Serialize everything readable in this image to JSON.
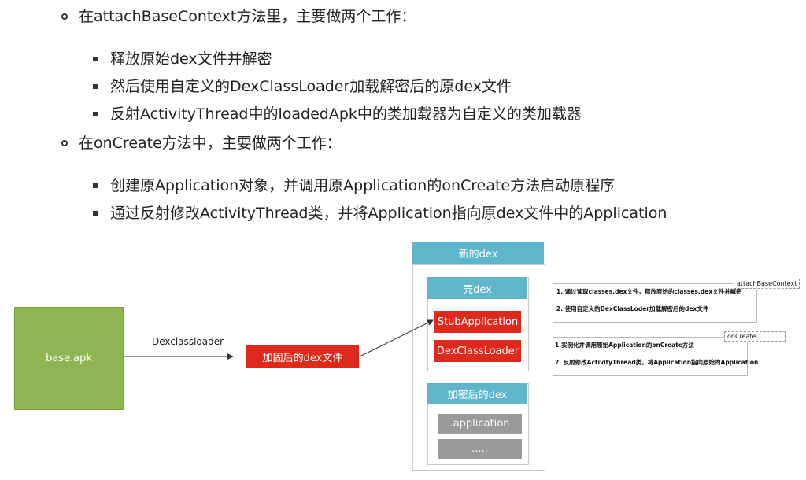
{
  "bullets": [
    {
      "text": "在attachBaseContext方法里，主要做两个工作：",
      "items": [
        "释放原始dex文件并解密",
        "然后使用自定义的DexClassLoader加载解密后的原dex文件",
        "反射ActivityThread中的loadedApk中的类加载器为自定义的类加载器"
      ]
    },
    {
      "text": "在onCreate方法中，主要做两个工作：",
      "items": [
        "创建原Application对象，并调用原Application的onCreate方法启动原程序",
        "通过反射修改ActivityThread类，并将Application指向原dex文件中的Application"
      ]
    }
  ],
  "diagram": {
    "base_apk": "base.apk",
    "edge_label": "Dexclassloader",
    "encrypted_file": "加固后的dex文件",
    "new_dex": "新的dex",
    "shell_dex": "壳dex",
    "stub_app": "StubApplication",
    "dex_loader": "DexClassLoader",
    "encrypted_dex": "加密后的dex",
    "application": ".application",
    "ellipsis": "....."
  },
  "notes": {
    "attach_tag": "attachBaseContext",
    "attach_1": "1. 通过读取classes.dex文件，释放原始的classes.dex文件并解密",
    "attach_2": "2. 使用自定义的DexClassLoder加载解密后的dex文件",
    "oncreate_tag": "onCreate",
    "oncreate_1": "1.实例化并调用原始Application的onCreate方法",
    "oncreate_2": "2. 反射修改ActivityThread类，将Application指向原始的Application"
  },
  "colors": {
    "green": "#8db653",
    "red": "#dd2a1c",
    "teal": "#5fb6cc",
    "gray": "#9a9a9a",
    "outline": "#c8c8c8"
  }
}
